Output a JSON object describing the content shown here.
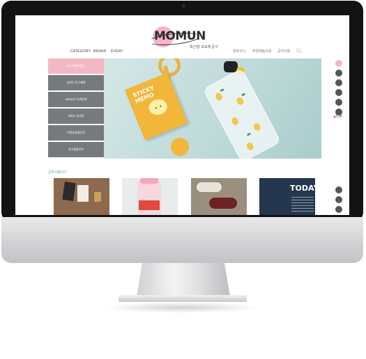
{
  "brand": {
    "logo": "MOMUN",
    "tagline": "특간형! 모모체 문구"
  },
  "nav": {
    "category": "CATEGORY",
    "brand": "BRAND",
    "event": "EVENT"
  },
  "util_menu": {
    "cart": "장바구니",
    "order": "주문배송조회",
    "notice": "공지사항"
  },
  "sidebar": {
    "items": [
      {
        "label": "본사/유통/현장"
      },
      {
        "label": "상위기 문구혜택"
      },
      {
        "label": "MMI상사 상위판대"
      },
      {
        "label": "대화사 임대전"
      },
      {
        "label": "이용동총불인전"
      },
      {
        "label": "링크총불이보"
      }
    ]
  },
  "hero": {
    "sticky_title": "STICKY\nMEMO"
  },
  "quickbar": {
    "top_label": "TOP"
  },
  "best": {
    "title": "금주의BEST",
    "today_text": "TODAY"
  },
  "colors": {
    "accent_pink": "#f2b9c4",
    "sidebar_gray": "#767a7c",
    "best_teal": "#5ab5a7"
  }
}
